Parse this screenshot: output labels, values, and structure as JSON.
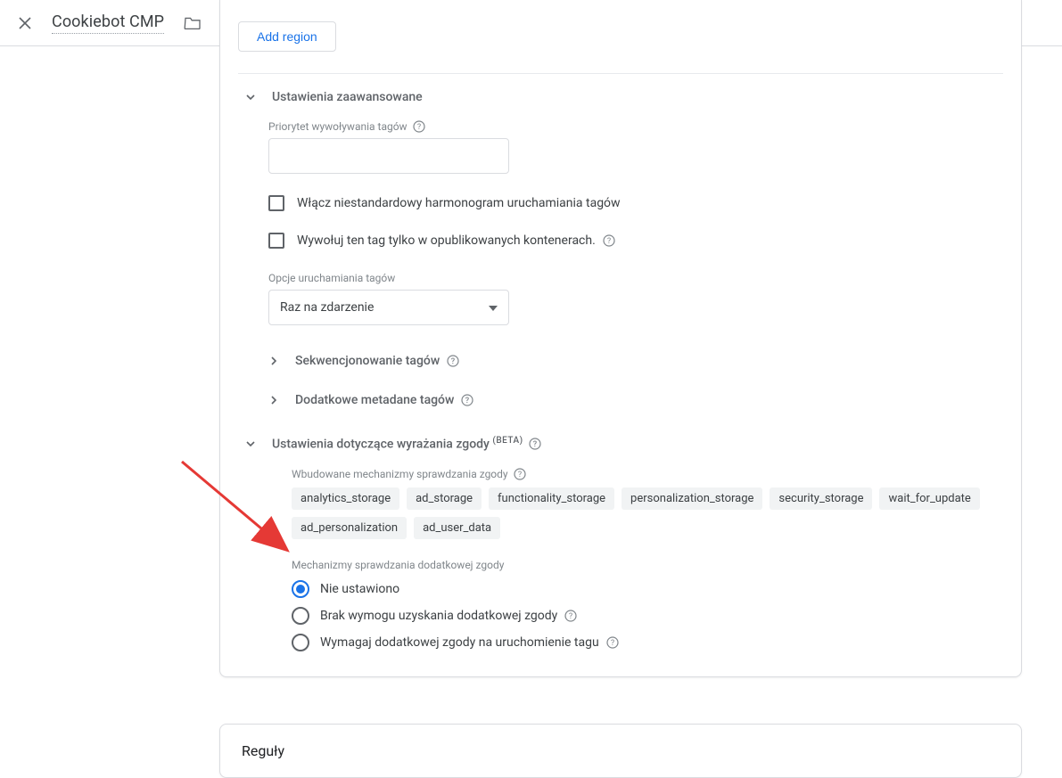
{
  "header": {
    "title": "Cookiebot CMP"
  },
  "card": {
    "add_region_btn": "Add region",
    "advanced": {
      "title": "Ustawienia zaawansowane",
      "priority_label": "Priorytet wywoływania tagów",
      "priority_value": "",
      "checkbox1": "Włącz niestandardowy harmonogram uruchamiania tagów",
      "checkbox2": "Wywołuj ten tag tylko w opublikowanych kontenerach.",
      "fire_options_label": "Opcje uruchamiania tagów",
      "fire_options_value": "Raz na zdarzenie",
      "seq_label": "Sekwencjonowanie tagów",
      "meta_label": "Dodatkowe metadane tagów"
    },
    "consent": {
      "title_main": "Ustawienia dotyczące wyrażania zgody ",
      "title_beta": "(BETA)",
      "builtin_label": "Wbudowane mechanizmy sprawdzania zgody",
      "chips": [
        "analytics_storage",
        "ad_storage",
        "functionality_storage",
        "personalization_storage",
        "security_storage",
        "wait_for_update",
        "ad_personalization",
        "ad_user_data"
      ],
      "additional_label": "Mechanizmy sprawdzania dodatkowej zgody",
      "radio1": "Nie ustawiono",
      "radio2": "Brak wymogu uzyskania dodatkowej zgody",
      "radio3": "Wymagaj dodatkowej zgody na uruchomienie tagu"
    }
  },
  "rules": {
    "title": "Reguły"
  }
}
